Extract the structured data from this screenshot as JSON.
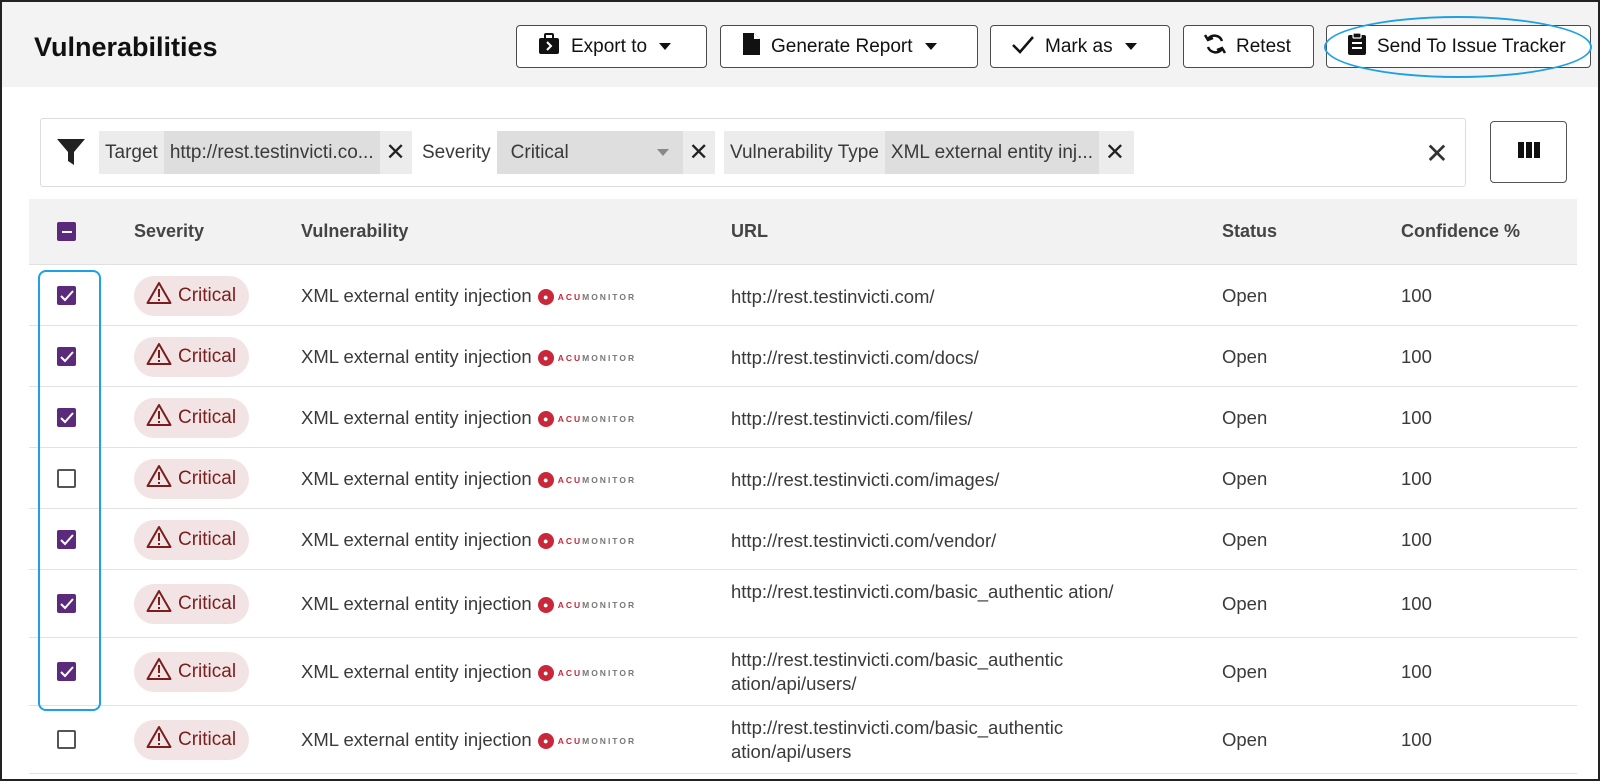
{
  "page": {
    "title": "Vulnerabilities"
  },
  "toolbar": {
    "export_label": "Export to",
    "report_label": "Generate Report",
    "mark_label": "Mark as",
    "retest_label": "Retest",
    "send_label": "Send To Issue Tracker"
  },
  "filters": {
    "target": {
      "key": "Target",
      "value": "http://rest.testinvicti.co..."
    },
    "severity": {
      "key": "Severity",
      "value": "Critical"
    },
    "vuln_type": {
      "key": "Vulnerability Type",
      "value": "XML external entity inj..."
    }
  },
  "table": {
    "headers": {
      "severity": "Severity",
      "vulnerability": "Vulnerability",
      "url": "URL",
      "status": "Status",
      "confidence": "Confidence %"
    },
    "acumonitor": {
      "prefix": "ACU",
      "suffix": "MONITOR"
    },
    "rows": [
      {
        "checked": true,
        "severity": "Critical",
        "vulnerability": "XML external entity injection",
        "url": "http://rest.testinvicti.com/",
        "status": "Open",
        "confidence": "100"
      },
      {
        "checked": true,
        "severity": "Critical",
        "vulnerability": "XML external entity injection",
        "url": "http://rest.testinvicti.com/docs/",
        "status": "Open",
        "confidence": "100"
      },
      {
        "checked": true,
        "severity": "Critical",
        "vulnerability": "XML external entity injection",
        "url": "http://rest.testinvicti.com/files/",
        "status": "Open",
        "confidence": "100"
      },
      {
        "checked": false,
        "severity": "Critical",
        "vulnerability": "XML external entity injection",
        "url": "http://rest.testinvicti.com/images/",
        "status": "Open",
        "confidence": "100"
      },
      {
        "checked": true,
        "severity": "Critical",
        "vulnerability": "XML external entity injection",
        "url": "http://rest.testinvicti.com/vendor/",
        "status": "Open",
        "confidence": "100"
      },
      {
        "checked": true,
        "severity": "Critical",
        "vulnerability": "XML external entity injection",
        "url": "http://rest.testinvicti.com/basic_authentic ation/",
        "status": "Open",
        "confidence": "100"
      },
      {
        "checked": true,
        "severity": "Critical",
        "vulnerability": "XML external entity injection",
        "url": "http://rest.testinvicti.com/basic_authentic ation/api/users/",
        "status": "Open",
        "confidence": "100"
      },
      {
        "checked": false,
        "severity": "Critical",
        "vulnerability": "XML external entity injection",
        "url": "http://rest.testinvicti.com/basic_authentic ation/api/users",
        "status": "Open",
        "confidence": "100"
      }
    ]
  },
  "colors": {
    "accent": "#5b2a7a",
    "critical_text": "#7a1d1d",
    "critical_bg": "#f2e4e4",
    "highlight": "#1da1e3"
  }
}
